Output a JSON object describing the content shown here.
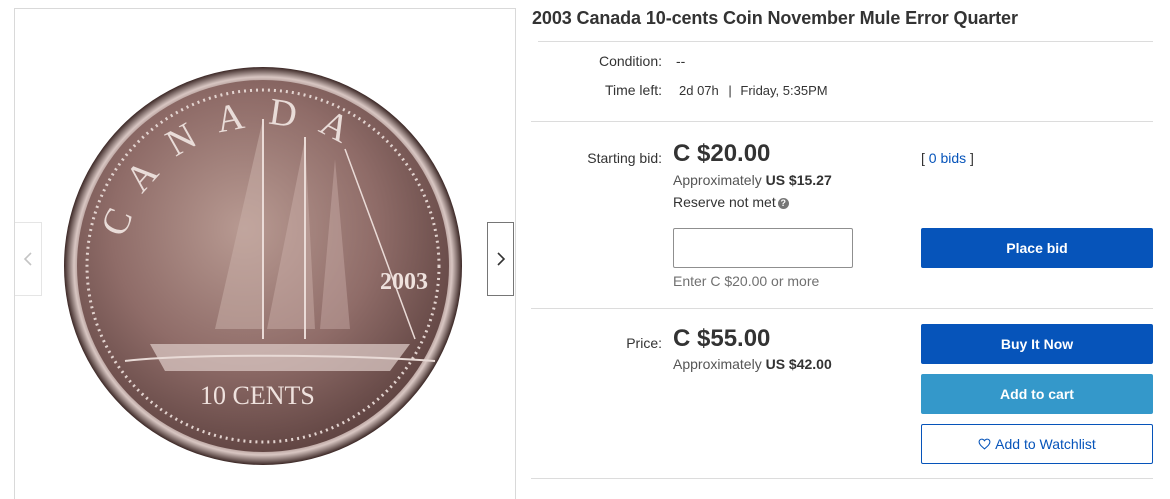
{
  "gallery": {
    "image_alt": "Canada 10 cents coin",
    "coin_text": {
      "country": "CANADA",
      "year": "2003",
      "denomination": "10 CENTS"
    },
    "prev_icon": "chevron-left-icon",
    "next_icon": "chevron-right-icon"
  },
  "listing": {
    "title": "2003 Canada 10-cents Coin November Mule Error Quarter",
    "condition_label": "Condition:",
    "condition_value": "--",
    "time_left_label": "Time left:",
    "time_left_value": "2d 07h",
    "time_left_sep": "|",
    "end_time": "Friday, 5:35PM"
  },
  "bid": {
    "label": "Starting bid:",
    "price": "C $20.00",
    "approx_prefix": "Approximately",
    "approx_value": "US $15.27",
    "reserve_text": "Reserve not met",
    "reserve_help_icon": "question-circle-icon",
    "bids_open": "[",
    "bids_link": "0 bids",
    "bids_close": "]",
    "input_value": "",
    "hint": "Enter C $20.00 or more",
    "place_bid": "Place bid"
  },
  "buy": {
    "label": "Price:",
    "price": "C $55.00",
    "approx_prefix": "Approximately",
    "approx_value": "US $42.00",
    "buy_now": "Buy It Now",
    "add_to_cart": "Add to cart",
    "watchlist_icon": "heart-icon",
    "add_to_watchlist": "Add to Watchlist"
  },
  "colors": {
    "primary": "#0654ba",
    "secondary": "#3498ca",
    "text": "#333333",
    "muted": "#707070"
  }
}
